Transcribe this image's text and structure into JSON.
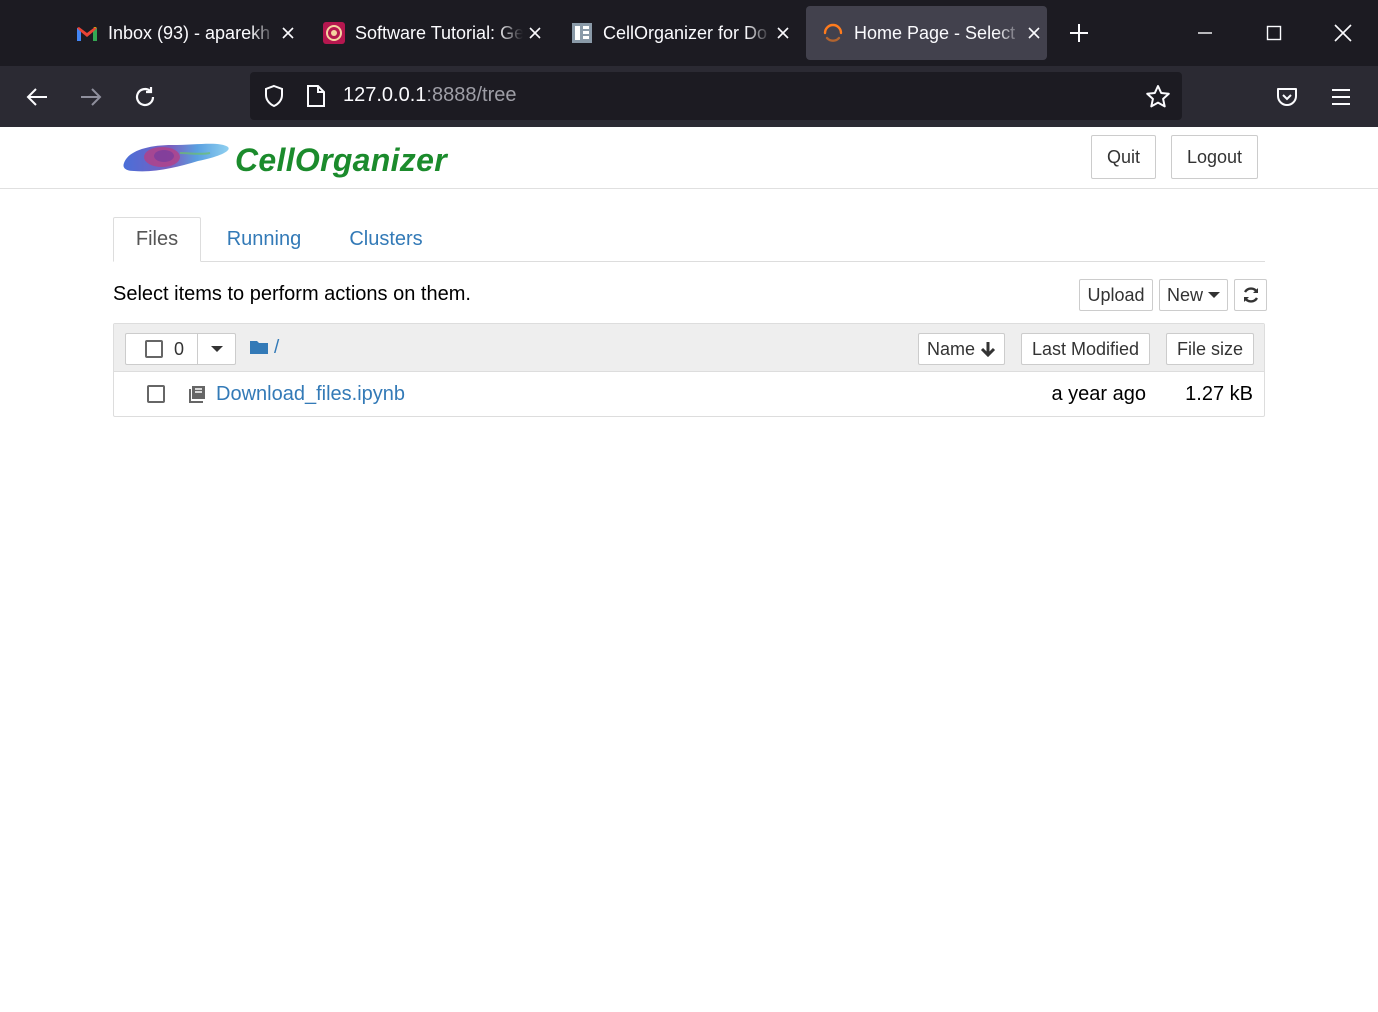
{
  "browser": {
    "tabs": [
      {
        "label": "Inbox (93) - aparekh",
        "favicon": "gmail-icon",
        "active": false
      },
      {
        "label": "Software Tutorial: Ge",
        "favicon": "cell-icon",
        "active": false
      },
      {
        "label": "CellOrganizer for Do",
        "favicon": "docs-icon",
        "active": false
      },
      {
        "label": "Home Page - Select",
        "favicon": "loading-spinner-icon",
        "active": true
      }
    ],
    "new_tab_icon": "plus-icon",
    "url_host": "127.0.0.1",
    "url_rest": ":8888/tree",
    "accent": "#fe7b1d"
  },
  "header": {
    "logo_text": "CellOrganizer",
    "quit_label": "Quit",
    "logout_label": "Logout"
  },
  "nav_tabs": [
    {
      "label": "Files",
      "active": true
    },
    {
      "label": "Running",
      "active": false
    },
    {
      "label": "Clusters",
      "active": false
    }
  ],
  "files": {
    "instructions": "Select items to perform actions on them.",
    "upload_label": "Upload",
    "new_label": "New",
    "selected_count": "0",
    "breadcrumb": "/",
    "sort_name_label": "Name",
    "last_modified_label": "Last Modified",
    "file_size_label": "File size",
    "items": [
      {
        "name": "Download_files.ipynb",
        "modified": "a year ago",
        "size": "1.27 kB",
        "icon": "notebook-icon"
      }
    ]
  },
  "colors": {
    "link": "#337ab7",
    "logo_green": "#1b8b2c"
  }
}
